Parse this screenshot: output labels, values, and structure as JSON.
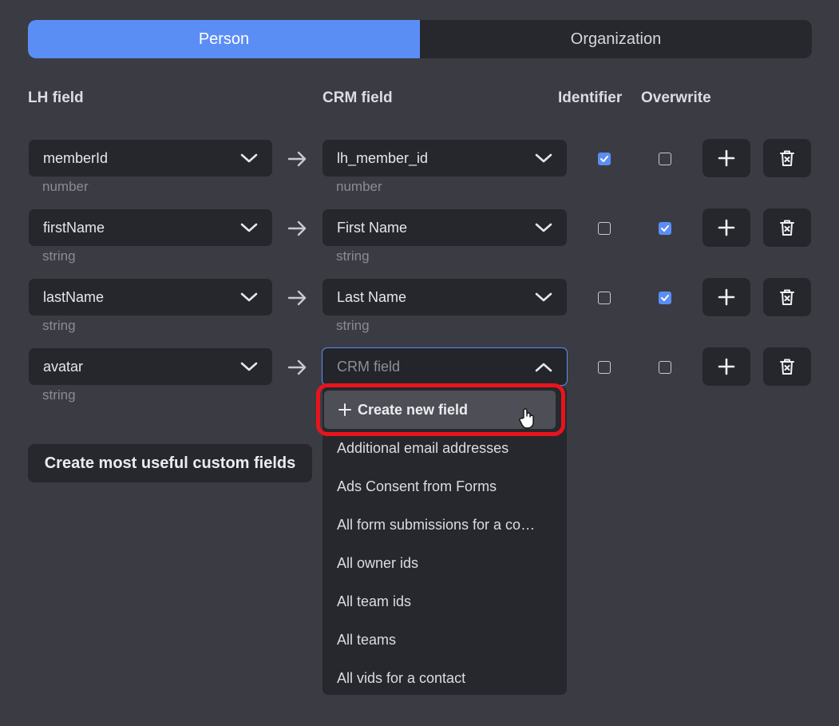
{
  "tabs": [
    {
      "label": "Person",
      "active": true
    },
    {
      "label": "Organization",
      "active": false
    }
  ],
  "headers": {
    "lh_field": "LH field",
    "crm_field": "CRM field",
    "identifier": "Identifier",
    "overwrite": "Overwrite"
  },
  "rows": [
    {
      "lh_field": "memberId",
      "lh_type": "number",
      "crm_field": "lh_member_id",
      "crm_type": "number",
      "identifier": true,
      "overwrite": false
    },
    {
      "lh_field": "firstName",
      "lh_type": "string",
      "crm_field": "First Name",
      "crm_type": "string",
      "identifier": false,
      "overwrite": true
    },
    {
      "lh_field": "lastName",
      "lh_type": "string",
      "crm_field": "Last Name",
      "crm_type": "string",
      "identifier": false,
      "overwrite": true
    },
    {
      "lh_field": "avatar",
      "lh_type": "string",
      "crm_field": "",
      "crm_placeholder": "CRM field",
      "crm_type": "",
      "identifier": false,
      "overwrite": false
    }
  ],
  "create_custom_button": "Create most useful custom fields",
  "dropdown": {
    "create_new": "Create new field",
    "options": [
      "Additional email addresses",
      "Ads Consent from Forms",
      "All form submissions for a co…",
      "All owner ids",
      "All team ids",
      "All teams",
      "All vids for a contact"
    ]
  },
  "colors": {
    "accent": "#5b8ef5",
    "highlight": "#e8141c",
    "background": "#3b3c43",
    "surface": "#27282d"
  }
}
